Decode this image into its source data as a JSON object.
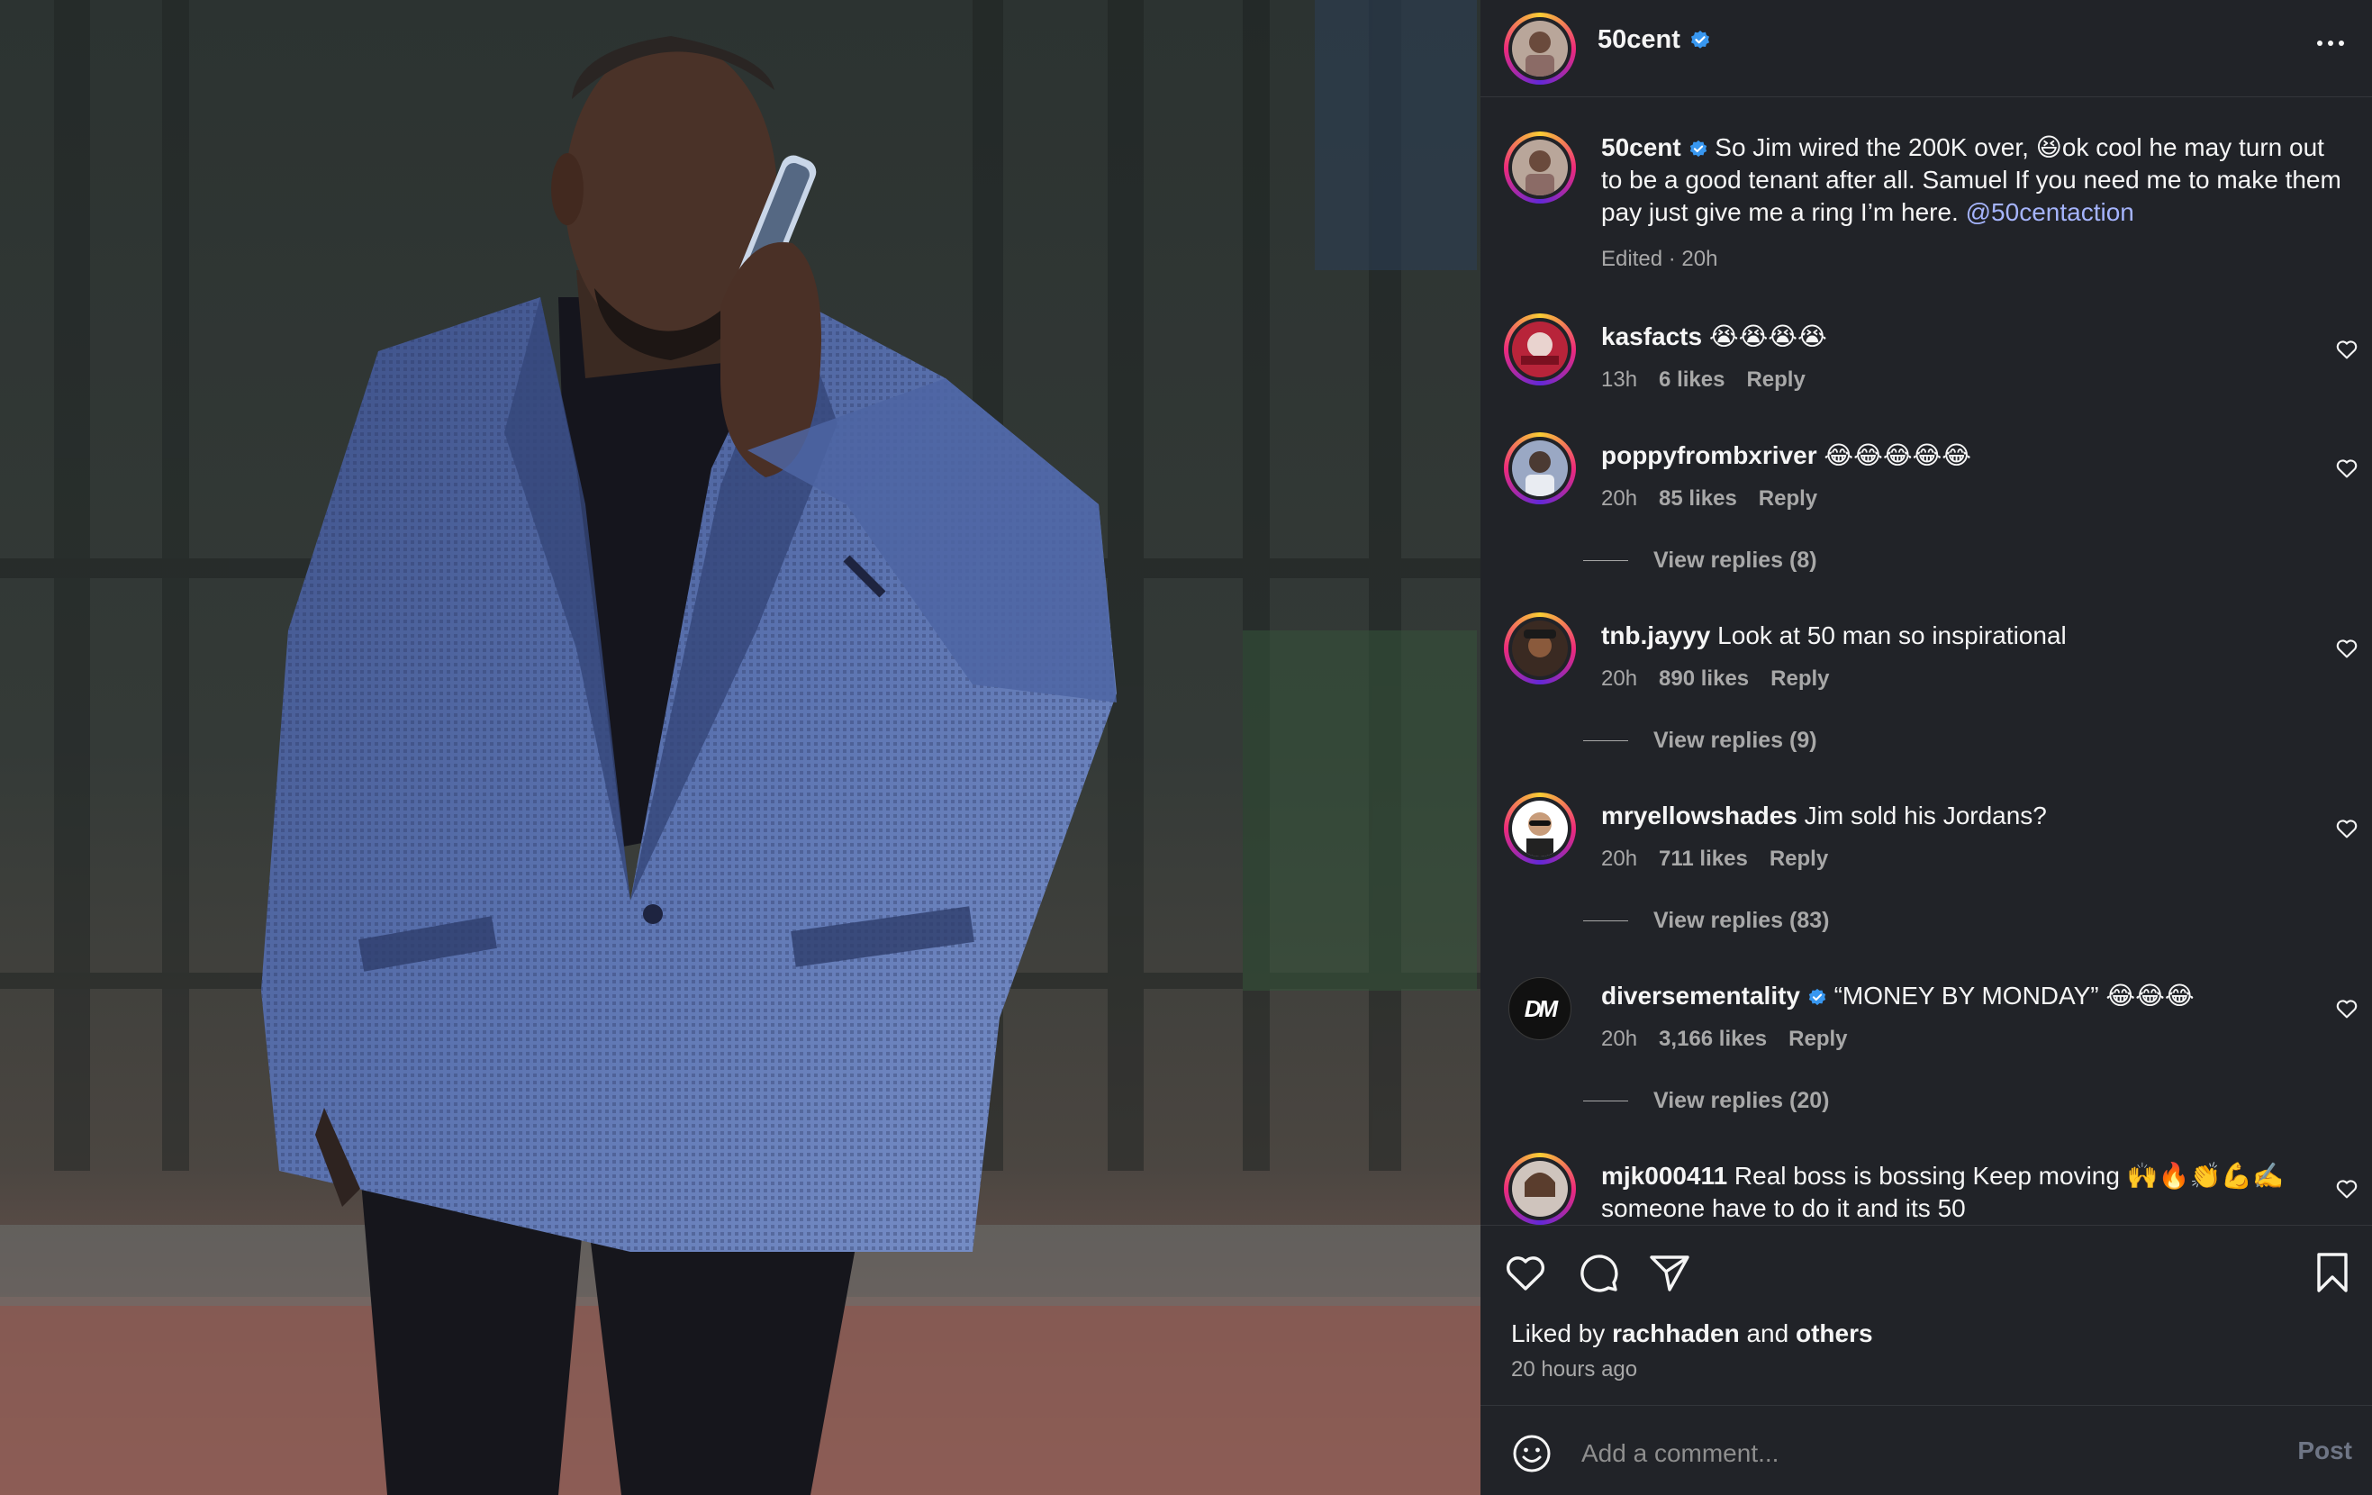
{
  "post": {
    "author": "50cent",
    "more_icon": "more-horizontal-icon"
  },
  "caption": {
    "author": "50cent",
    "text_part1": "So Jim wired the 200K over, 😆ok cool he may turn out to be a good tenant after all. Samuel If you need me to make them pay just give me a ring I’m here. ",
    "mention": "@50centaction",
    "edited_label": "Edited · 20h"
  },
  "comments": [
    {
      "user": "kasfacts",
      "text": "😭😭😭😭",
      "time": "13h",
      "likes": "6 likes",
      "reply": "Reply"
    },
    {
      "user": "poppyfrombxriver",
      "text": "😂😂😂😂😂",
      "time": "20h",
      "likes": "85 likes",
      "reply": "Reply",
      "view_replies": "View replies (8)"
    },
    {
      "user": "tnb.jayyy",
      "text": "Look at 50 man so inspirational",
      "time": "20h",
      "likes": "890 likes",
      "reply": "Reply",
      "view_replies": "View replies (9)"
    },
    {
      "user": "mryellowshades",
      "text": "Jim sold his Jordans?",
      "time": "20h",
      "likes": "711 likes",
      "reply": "Reply",
      "view_replies": "View replies (83)"
    },
    {
      "user": "diversementality",
      "verified": true,
      "text": "“MONEY BY MONDAY” 😂😂😂",
      "time": "20h",
      "likes": "3,166 likes",
      "reply": "Reply",
      "view_replies": "View replies (20)",
      "avatar_logo": "DM"
    },
    {
      "user": "mjk000411",
      "text": "Real boss is bossing Keep moving 🙌🔥👏💪✍️someone have to do it and its 50"
    }
  ],
  "actions": {
    "liked_prefix": "Liked by ",
    "liked_user": "rachhaden",
    "liked_and": " and ",
    "liked_others": "others",
    "time_ago": "20 hours ago"
  },
  "composer": {
    "placeholder": "Add a comment...",
    "post_label": "Post"
  },
  "colors": {
    "panel_bg": "#212328",
    "verified": "#3897f0",
    "mention": "#a5b4fc",
    "secondary_text": "#a8a8a8"
  }
}
